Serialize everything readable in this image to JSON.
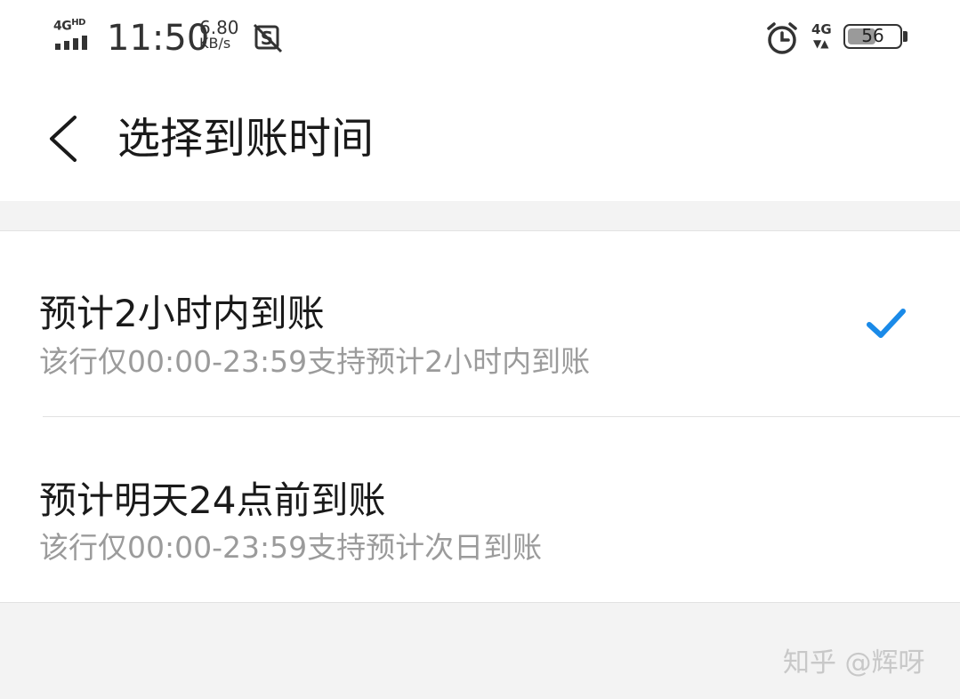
{
  "status_bar": {
    "network_label": "4G",
    "network_hd": "HD",
    "time": "11:50",
    "net_speed_value": "6.80",
    "net_speed_unit": "KB/s",
    "right_network": "4G",
    "battery_level": "56",
    "battery_fraction": 0.56
  },
  "header": {
    "title": "选择到账时间",
    "back_icon": "chevron-left-icon"
  },
  "options": [
    {
      "title": "预计2小时内到账",
      "subtitle": "该行仅00:00-23:59支持预计2小时内到账",
      "selected": true
    },
    {
      "title": "预计明天24点前到账",
      "subtitle": "该行仅00:00-23:59支持预计次日到账",
      "selected": false
    }
  ],
  "watermark": "知乎 @辉呀",
  "colors": {
    "accent": "#1a8ae8",
    "background": "#f3f3f3",
    "secondary_text": "#9b9b9b"
  }
}
